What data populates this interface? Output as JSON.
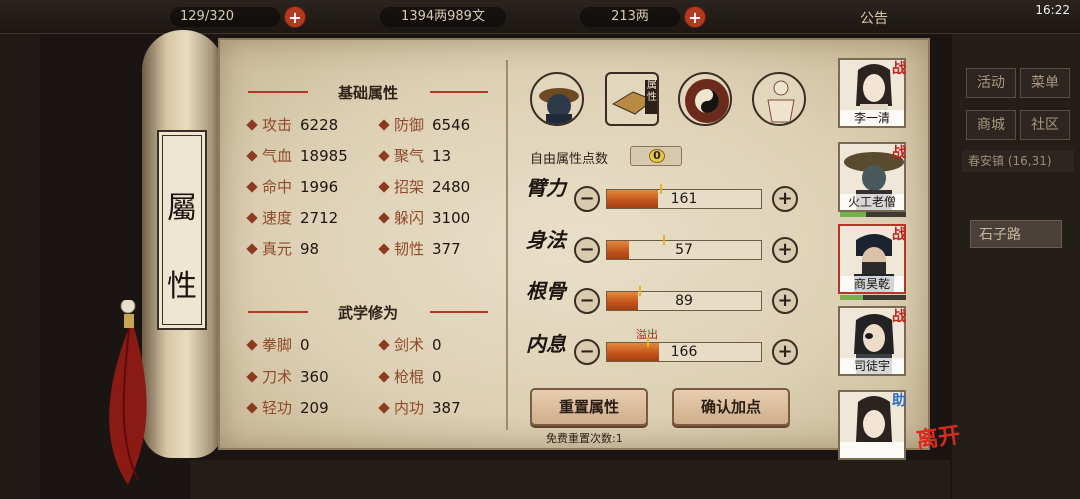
{
  "topbar": {
    "stamina": "129/320",
    "money": "1394两989文",
    "gold": "213两",
    "announcement": "公告",
    "time": "16:22"
  },
  "scroll_label": "屬性",
  "base_section": {
    "title": "基础属性",
    "stats": [
      {
        "label": "攻击",
        "value": "6228"
      },
      {
        "label": "防御",
        "value": "6546"
      },
      {
        "label": "气血",
        "value": "18985"
      },
      {
        "label": "聚气",
        "value": "13"
      },
      {
        "label": "命中",
        "value": "1996"
      },
      {
        "label": "招架",
        "value": "2480"
      },
      {
        "label": "速度",
        "value": "2712"
      },
      {
        "label": "躲闪",
        "value": "3100"
      },
      {
        "label": "真元",
        "value": "98"
      },
      {
        "label": "韧性",
        "value": "377"
      }
    ]
  },
  "martial_section": {
    "title": "武学修为",
    "stats": [
      {
        "label": "拳脚",
        "value": "0"
      },
      {
        "label": "剑术",
        "value": "0"
      },
      {
        "label": "刀术",
        "value": "360"
      },
      {
        "label": "枪棍",
        "value": "0"
      },
      {
        "label": "轻功",
        "value": "209"
      },
      {
        "label": "内功",
        "value": "387"
      }
    ]
  },
  "tabs": [
    {
      "icon": "character-portrait-icon"
    },
    {
      "icon": "attribute-book-icon",
      "label": "属性"
    },
    {
      "icon": "bagua-icon"
    },
    {
      "icon": "meridian-body-icon"
    }
  ],
  "free_points": {
    "label": "自由属性点数",
    "value": "0"
  },
  "attributes": [
    {
      "name": "臂力",
      "value": "161",
      "fill": 0.33
    },
    {
      "name": "身法",
      "value": "57",
      "fill": 0.14
    },
    {
      "name": "根骨",
      "value": "89",
      "fill": 0.2
    },
    {
      "name": "内息",
      "value": "166",
      "fill": 0.34
    }
  ],
  "overflow_label": "溢出",
  "buttons": {
    "reset": "重置属性",
    "confirm": "确认加点"
  },
  "reset_count": "免费重置次数:1",
  "party": [
    {
      "name": "李一清",
      "badge": "战"
    },
    {
      "name": "火工老僧",
      "badge": "战"
    },
    {
      "name": "商昊乾",
      "badge": "战"
    },
    {
      "name": "司徒宇",
      "badge": "战"
    },
    {
      "name": "",
      "badge": "助"
    }
  ],
  "leave": "离开",
  "right_menu": [
    "活动",
    "菜单",
    "商城",
    "社区"
  ],
  "location": "春安镇 (16,31)",
  "road": "石子路",
  "colors": {
    "accent_red": "#b03a26",
    "bar_orange": "#d2621f",
    "hp_green": "#77b14e"
  }
}
